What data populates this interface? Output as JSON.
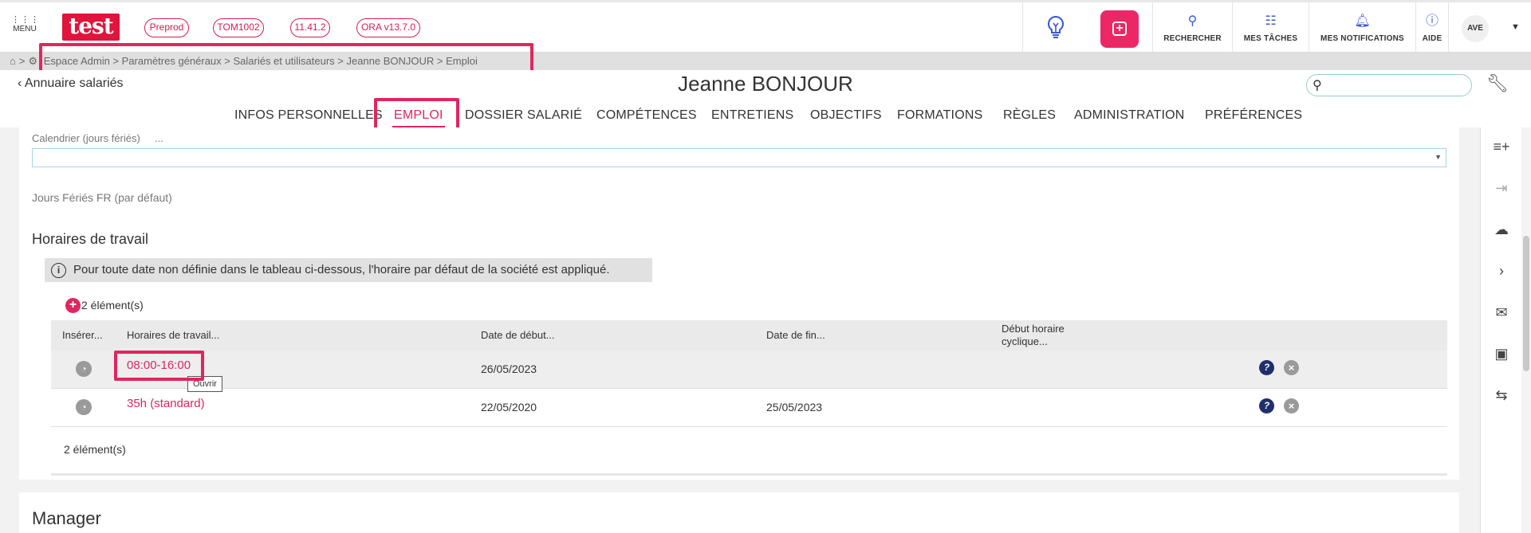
{
  "topbar": {
    "menu_label": "MENU",
    "logo_text": "test",
    "pills": [
      "Preprod",
      "TOM1002",
      "11.41.2",
      "ORA v13.7.0"
    ],
    "nav": [
      {
        "label": "RECHERCHER",
        "icon": "search-icon"
      },
      {
        "label": "MES TÂCHES",
        "icon": "tasks-icon"
      },
      {
        "label": "MES NOTIFICATIONS",
        "icon": "bell-icon"
      },
      {
        "label": "AIDE",
        "icon": "help-icon"
      }
    ],
    "user_initials": "AVE"
  },
  "breadcrumb": {
    "text": "Espace Admin > Paramètres généraux > Salariés et utilisateurs > Jeanne BONJOUR > Emploi"
  },
  "employee": {
    "back_label": "Annuaire salariés",
    "name": "Jeanne BONJOUR"
  },
  "tabs": [
    {
      "label": "INFOS PERSONNELLES",
      "active": false
    },
    {
      "label": "EMPLOI",
      "active": true
    },
    {
      "label": "DOSSIER SALARIÉ",
      "active": false
    },
    {
      "label": "COMPÉTENCES",
      "active": false
    },
    {
      "label": "ENTRETIENS",
      "active": false
    },
    {
      "label": "OBJECTIFS",
      "active": false
    },
    {
      "label": "FORMATIONS",
      "active": false
    },
    {
      "label": "RÈGLES",
      "active": false
    },
    {
      "label": "ADMINISTRATION",
      "active": false
    },
    {
      "label": "PRÉFÉRENCES",
      "active": false
    }
  ],
  "calendar": {
    "label": "Calendrier (jours fériés)",
    "label_suffix": "...",
    "value_text": "Jours Fériés FR (par défaut)"
  },
  "work_hours": {
    "title": "Horaires de travail",
    "info": "Pour toute date non définie dans le tableau ci-dessous, l'horaire par défaut de la société est appliqué.",
    "add_count": "2 élément(s)",
    "columns": [
      "Insérer...",
      "Horaires de travail...",
      "Date de début...",
      "Date de fin...",
      "Début horaire cyclique..."
    ],
    "rows": [
      {
        "schedule": "08:00-16:00",
        "start": "26/05/2023",
        "end": ""
      },
      {
        "schedule": "35h (standard)",
        "start": "22/05/2020",
        "end": "25/05/2023"
      }
    ],
    "tooltip": "Ouvrir",
    "footer_count": "2 élément(s)"
  },
  "manager": {
    "title": "Manager"
  },
  "colors": {
    "accent": "#e0265e",
    "icon_blue": "#3b57d1"
  }
}
